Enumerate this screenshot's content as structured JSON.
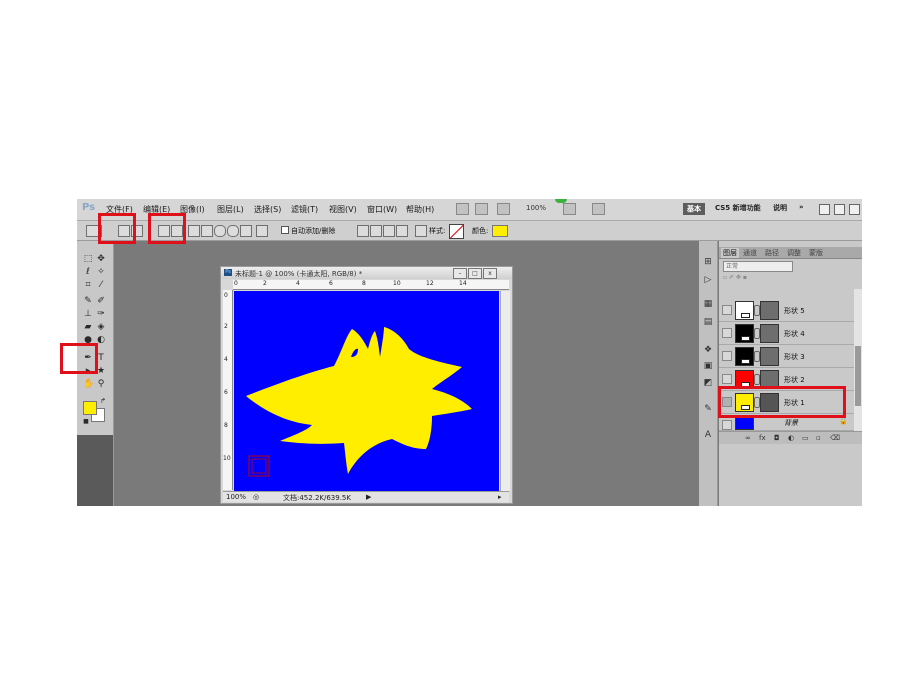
{
  "menubar": {
    "logo": "Ps",
    "items": [
      "文件(F)",
      "编辑(E)",
      "图像(I)",
      "图层(L)",
      "选择(S)",
      "滤镜(T)",
      "视图(V)",
      "窗口(W)",
      "帮助(H)"
    ],
    "zoom": "100%",
    "workspaces": [
      "基本",
      "CS5 新增功能",
      "说明",
      "»"
    ]
  },
  "optionsbar": {
    "auto_add_delete": "自动添加/删除",
    "style_label": "样式:",
    "color_label": "颜色:",
    "color_value": "#ffee00"
  },
  "toolbox": {
    "foreground_color": "#ffee00",
    "background_color": "#ffffff"
  },
  "document": {
    "title": "未标题-1 @ 100% (卡通太阳, RGB/8) *",
    "ruler_top": [
      "0",
      "2",
      "4",
      "6",
      "8",
      "10",
      "12",
      "14"
    ],
    "ruler_left": [
      "0",
      "2",
      "4",
      "6",
      "8",
      "10"
    ],
    "zoom": "100%",
    "doc_info": "文档:452.2K/639.5K",
    "canvas_color": "#0000ff",
    "shape_color": "#ffee00"
  },
  "layers_panel": {
    "tabs": [
      "图层",
      "通道",
      "路径",
      "调整",
      "蒙版"
    ],
    "blend_mode": "正常",
    "layers": [
      {
        "name": "形状 5",
        "color": "#ffffff"
      },
      {
        "name": "形状 4",
        "color": "#000000"
      },
      {
        "name": "形状 3",
        "color": "#000000"
      },
      {
        "name": "形状 2",
        "color": "#ff0000"
      },
      {
        "name": "形状 1",
        "color": "#ffee00"
      },
      {
        "name": "背景",
        "color": "#0000ff"
      }
    ]
  }
}
